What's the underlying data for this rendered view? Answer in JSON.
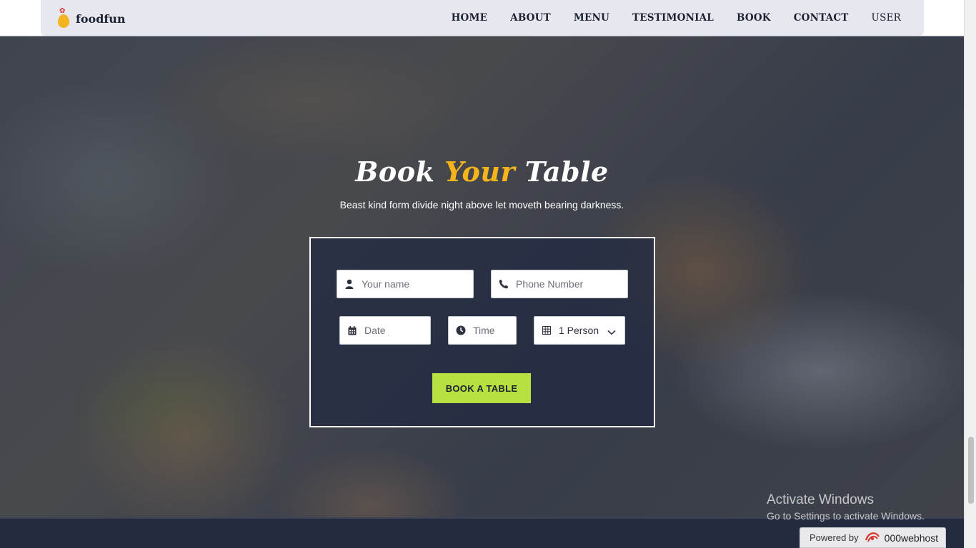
{
  "brand": {
    "name": "foodfun",
    "logo_icon": "chicken-egg-icon",
    "accent": "#f2b51f"
  },
  "nav": {
    "items": [
      {
        "label": "HOME"
      },
      {
        "label": "ABOUT"
      },
      {
        "label": "MENU"
      },
      {
        "label": "TESTIMONIAL"
      },
      {
        "label": "BOOK"
      },
      {
        "label": "CONTACT"
      },
      {
        "label": "USER"
      }
    ]
  },
  "hero": {
    "title_part1": "Book",
    "title_part2": "Your",
    "title_part3": "Table",
    "subtitle": "Beast kind form divide night above let moveth bearing darkness.",
    "title_accent_color": "#f4b41a"
  },
  "form": {
    "name": {
      "placeholder": "Your name",
      "icon": "user-icon"
    },
    "phone": {
      "placeholder": "Phone Number",
      "icon": "phone-icon"
    },
    "date": {
      "placeholder": "Date",
      "icon": "calendar-icon"
    },
    "time": {
      "placeholder": "Time",
      "icon": "clock-icon"
    },
    "persons": {
      "value": "1 Person",
      "icon": "grid-icon"
    },
    "submit_label": "BOOK A TABLE",
    "submit_color": "#b7e041"
  },
  "watermark": {
    "line1": "Activate Windows",
    "line2": "Go to Settings to activate Windows."
  },
  "hosting": {
    "prefix": "Powered by",
    "brand": "000webhost"
  }
}
